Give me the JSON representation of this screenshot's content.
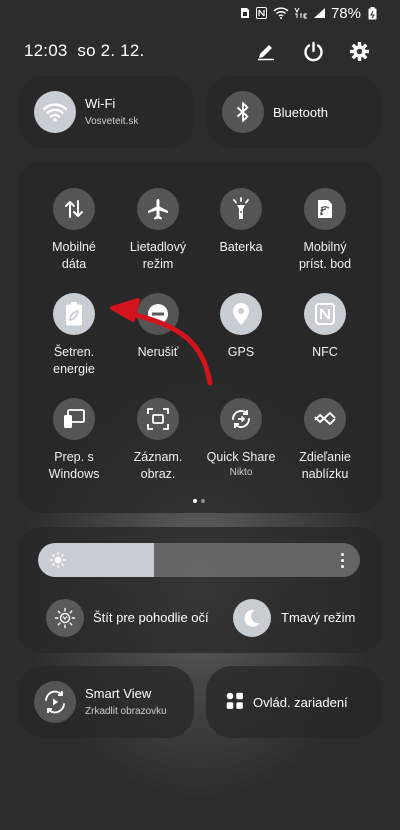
{
  "status_bar": {
    "battery": "78%",
    "icons": [
      "sim-icon",
      "nfc-icon",
      "wifi-icon",
      "volte-icon",
      "signal-icon",
      "battery-icon"
    ]
  },
  "header": {
    "time": "12:03",
    "date": "so 2. 12.",
    "icons": [
      "edit-icon",
      "power-icon",
      "settings-icon"
    ]
  },
  "wifi": {
    "title": "Wi-Fi",
    "subtitle": "Vosveteit.sk",
    "on": true
  },
  "bluetooth": {
    "title": "Bluetooth",
    "on": false
  },
  "quick_toggles": [
    {
      "label": "Mobilné\ndáta",
      "icon": "mobile-data-icon",
      "on": false
    },
    {
      "label": "Lietadlový\nrežim",
      "icon": "airplane-icon",
      "on": false
    },
    {
      "label": "Baterka",
      "icon": "flashlight-icon",
      "on": false
    },
    {
      "label": "Mobilný\npríst. bod",
      "icon": "hotspot-icon",
      "on": false
    },
    {
      "label": "Šetren.\nenergie",
      "icon": "power-saving-icon",
      "on": true
    },
    {
      "label": "Nerušiť",
      "icon": "do-not-disturb-icon",
      "on": false
    },
    {
      "label": "GPS",
      "icon": "location-icon",
      "on": true
    },
    {
      "label": "NFC",
      "icon": "nfc-icon",
      "on": true
    },
    {
      "label": "Prep. s\nWindows",
      "icon": "link-windows-icon",
      "on": false
    },
    {
      "label": "Záznam.\nobraz.",
      "icon": "screen-record-icon",
      "on": false
    },
    {
      "label": "Quick Share",
      "sublabel": "Nikto",
      "icon": "quick-share-icon",
      "on": false
    },
    {
      "label": "Zdieľanie\nnablízku",
      "icon": "nearby-share-icon",
      "on": false
    }
  ],
  "page_indicator": {
    "current": 1,
    "total": 2
  },
  "brightness": {
    "level": 0.36
  },
  "eye_comfort": {
    "label": "Štít pre pohodlie očí",
    "on": false
  },
  "dark_mode": {
    "label": "Tmavý režim",
    "on": true
  },
  "smart_view": {
    "title": "Smart View",
    "subtitle": "Zrkadlit obrazovku"
  },
  "device_control": {
    "title": "Ovlád. zariadení"
  },
  "annotation": {
    "type": "arrow",
    "color": "#d4141c"
  }
}
